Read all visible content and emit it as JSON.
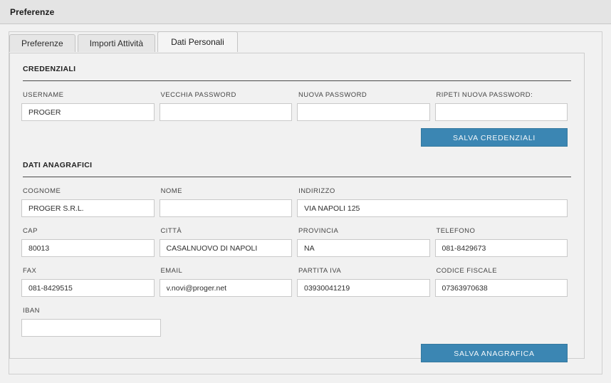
{
  "window": {
    "title": "Preferenze"
  },
  "tabs": [
    {
      "label": "Preferenze",
      "active": false
    },
    {
      "label": "Importi Attività",
      "active": false
    },
    {
      "label": "Dati Personali",
      "active": true
    }
  ],
  "sections": {
    "credenziali": {
      "title": "CREDENZIALI",
      "fields": [
        {
          "label": "USERNAME",
          "value": "PROGER",
          "placeholder": ""
        },
        {
          "label": "VECCHIA PASSWORD",
          "value": "",
          "placeholder": ""
        },
        {
          "label": "NUOVA PASSWORD",
          "value": "",
          "placeholder": ""
        },
        {
          "label": "RIPETI NUOVA PASSWORD:",
          "value": "",
          "placeholder": ""
        }
      ],
      "save_label": "SALVA CREDENZIALI"
    },
    "anagrafici": {
      "title": "DATI ANAGRAFICI",
      "fields": [
        {
          "label": "COGNOME",
          "value": "PROGER S.R.L.",
          "placeholder": ""
        },
        {
          "label": "NOME",
          "value": "",
          "placeholder": ""
        },
        {
          "label": "INDIRIZZO",
          "value": "VIA NAPOLI 125",
          "placeholder": ""
        },
        {
          "label": "CAP",
          "value": "80013",
          "placeholder": ""
        },
        {
          "label": "CITTÀ",
          "value": "CASALNUOVO DI NAPOLI",
          "placeholder": ""
        },
        {
          "label": "PROVINCIA",
          "value": "NA",
          "placeholder": ""
        },
        {
          "label": "TELEFONO",
          "value": "081-8429673",
          "placeholder": ""
        },
        {
          "label": "FAX",
          "value": "081-8429515",
          "placeholder": ""
        },
        {
          "label": "EMAIL",
          "value": "v.novi@proger.net",
          "placeholder": ""
        },
        {
          "label": "PARTITA IVA",
          "value": "03930041219",
          "placeholder": ""
        },
        {
          "label": "CODICE FISCALE",
          "value": "07363970638",
          "placeholder": ""
        },
        {
          "label": "IBAN",
          "value": "",
          "placeholder": ""
        }
      ],
      "save_label": "SALVA ANAGRAFICA"
    }
  },
  "colors": {
    "accent": "#3b86b3",
    "page_bg": "#f1f1f1",
    "header_bg": "#e4e4e4",
    "input_bg": "#ffffff",
    "rule": "#4a4a4a"
  }
}
